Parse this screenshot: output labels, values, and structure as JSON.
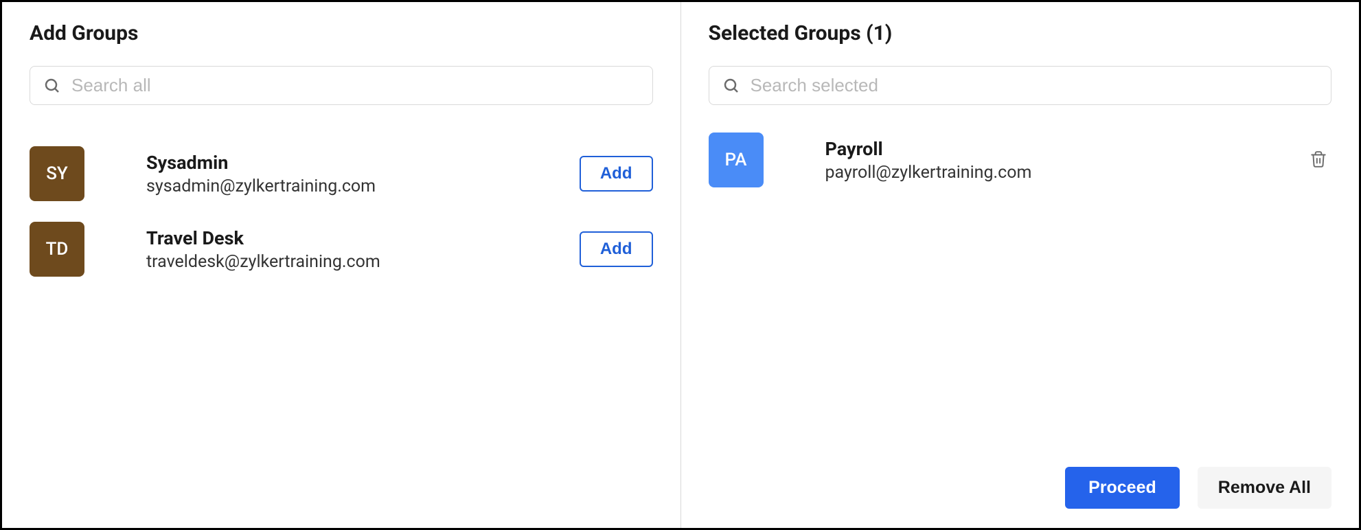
{
  "left": {
    "title": "Add Groups",
    "search_placeholder": "Search all",
    "groups": [
      {
        "initials": "SY",
        "name": "Sysadmin",
        "email": "sysadmin@zylkertraining.com",
        "add_label": "Add",
        "avatar_color": "brown"
      },
      {
        "initials": "TD",
        "name": "Travel Desk",
        "email": "traveldesk@zylkertraining.com",
        "add_label": "Add",
        "avatar_color": "brown"
      }
    ]
  },
  "right": {
    "title": "Selected Groups (1)",
    "search_placeholder": "Search selected",
    "groups": [
      {
        "initials": "PA",
        "name": "Payroll",
        "email": "payroll@zylkertraining.com",
        "avatar_color": "blue"
      }
    ]
  },
  "footer": {
    "proceed_label": "Proceed",
    "remove_all_label": "Remove All"
  }
}
